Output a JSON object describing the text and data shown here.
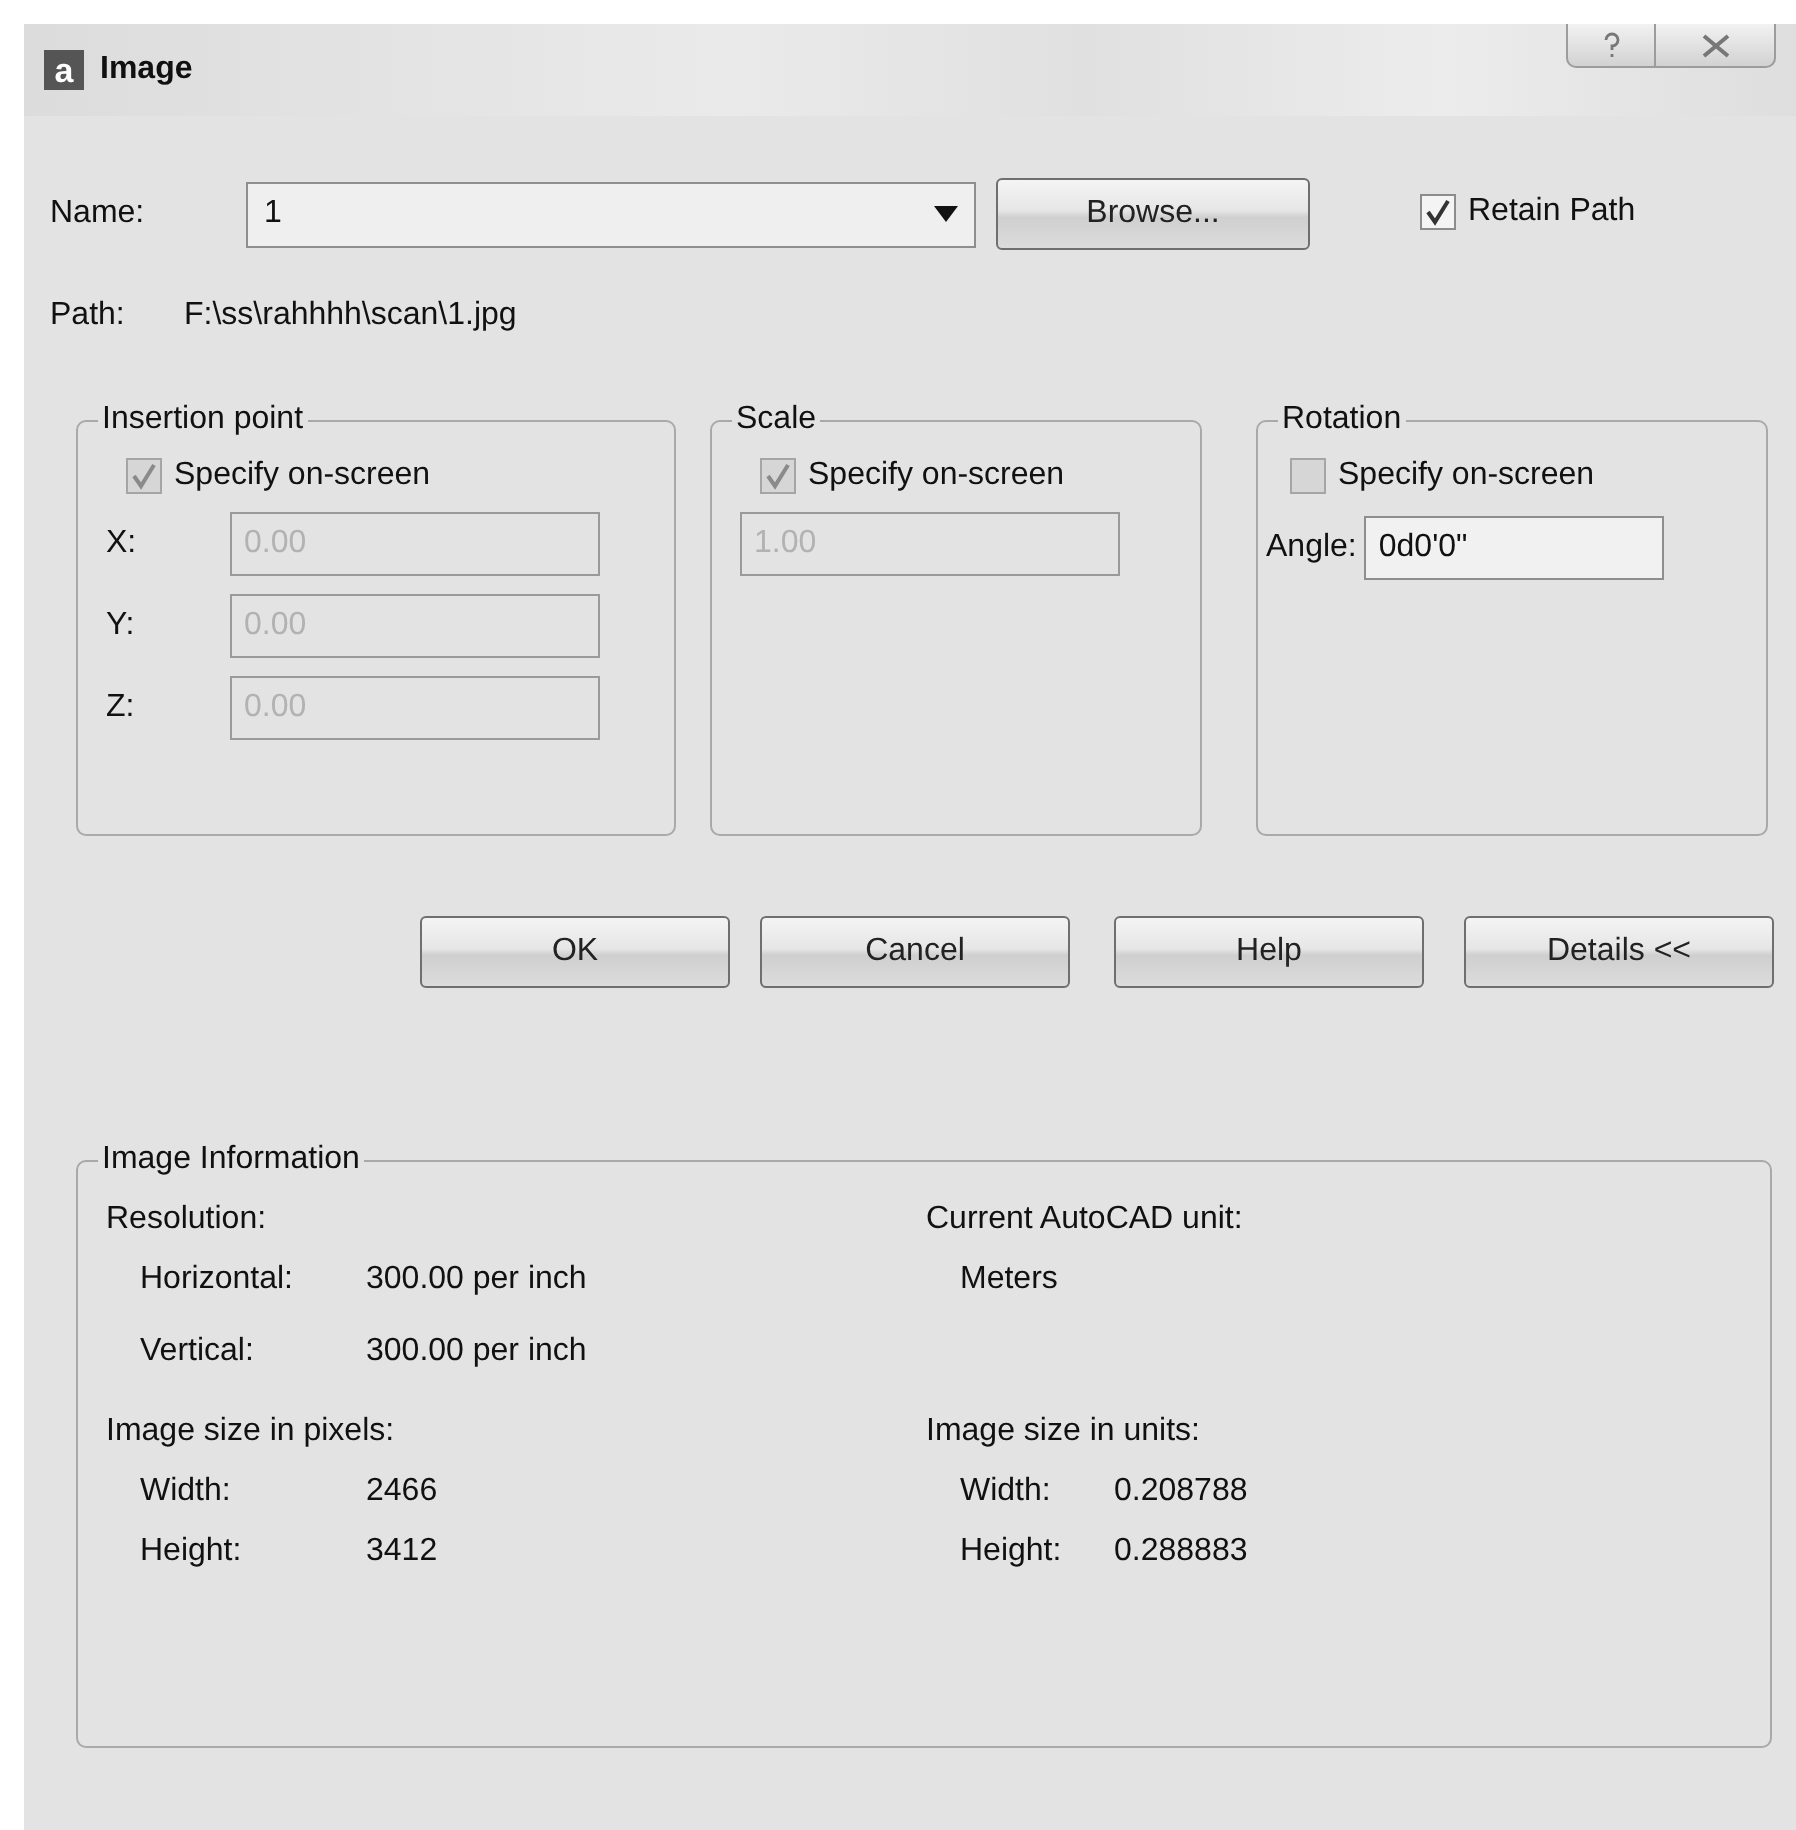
{
  "window": {
    "title": "Image",
    "icon_letter": "a"
  },
  "name": {
    "label": "Name:",
    "value": "1"
  },
  "browse_button": "Browse...",
  "retain_path": {
    "label": "Retain Path",
    "checked": true
  },
  "path": {
    "label": "Path:",
    "value": "F:\\ss\\rahhhh\\scan\\1.jpg"
  },
  "groups": [
    {
      "title": "Insertion point",
      "checkbox": {
        "label": "Specify on-screen",
        "checked": true,
        "disabled": true
      },
      "fields": [
        {
          "label": "X:",
          "value": "0.00",
          "disabled": true
        },
        {
          "label": "Y:",
          "value": "0.00",
          "disabled": true
        },
        {
          "label": "Z:",
          "value": "0.00",
          "disabled": true
        }
      ]
    },
    {
      "title": "Scale",
      "checkbox": {
        "label": "Specify on-screen",
        "checked": true,
        "disabled": true
      },
      "fields": [
        {
          "value": "1.00",
          "disabled": true
        }
      ]
    },
    {
      "title": "Rotation",
      "checkbox": {
        "label": "Specify on-screen",
        "checked": false,
        "disabled": true
      },
      "fields": [
        {
          "label": "Angle:",
          "value": "0d0'0\"",
          "disabled": false
        }
      ]
    }
  ],
  "buttons": [
    "OK",
    "Cancel",
    "Help",
    "Details <<"
  ],
  "info": {
    "title": "Image Information",
    "sections": [
      {
        "heading": "Resolution:",
        "rows": [
          {
            "label": "Horizontal:",
            "value": "300.00 per inch"
          },
          {
            "label": "Vertical:",
            "value": "300.00 per inch"
          }
        ]
      },
      {
        "heading": "Current AutoCAD unit:",
        "rows": [
          {
            "value": "Meters"
          }
        ]
      },
      {
        "heading": "Image size in pixels:",
        "rows": [
          {
            "label": "Width:",
            "value": "2466"
          },
          {
            "label": "Height:",
            "value": "3412"
          }
        ]
      },
      {
        "heading": "Image size in units:",
        "rows": [
          {
            "label": "Width:",
            "value": "0.208788"
          },
          {
            "label": "Height:",
            "value": "0.288883"
          }
        ]
      }
    ]
  }
}
